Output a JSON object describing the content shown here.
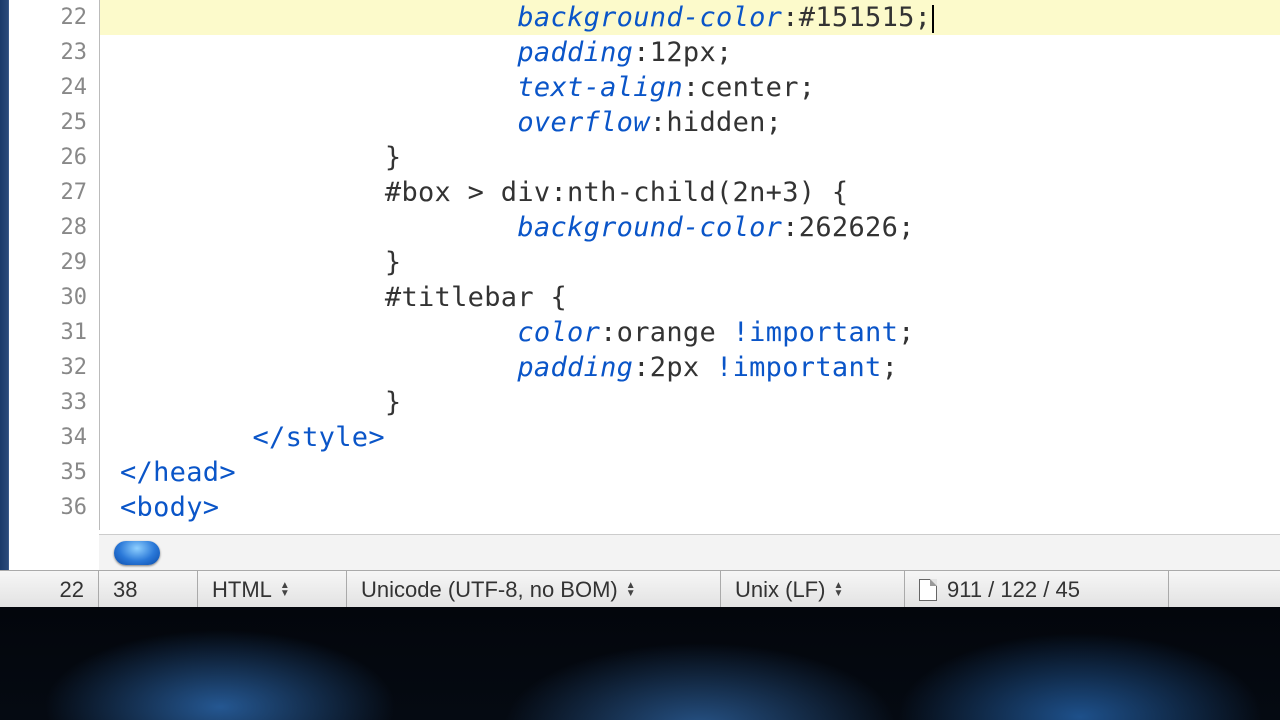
{
  "lines": [
    {
      "n": 22,
      "html": "                        <span class='prop'>background-color</span>:#151515;",
      "current": true
    },
    {
      "n": 23,
      "html": "                        <span class='prop'>padding</span>:12px;"
    },
    {
      "n": 24,
      "html": "                        <span class='prop'>text-align</span>:center;"
    },
    {
      "n": 25,
      "html": "                        <span class='prop'>overflow</span>:hidden;"
    },
    {
      "n": 26,
      "html": "                }"
    },
    {
      "n": 27,
      "html": "                #box &gt; div:nth-child(2n+3) {"
    },
    {
      "n": 28,
      "html": "                        <span class='prop'>background-color</span>:262626;"
    },
    {
      "n": 29,
      "html": "                }"
    },
    {
      "n": 30,
      "html": "                #titlebar {"
    },
    {
      "n": 31,
      "html": "                        <span class='prop'>color</span>:orange <span class='imp'>!important</span>;"
    },
    {
      "n": 32,
      "html": "                        <span class='prop'>padding</span>:2px <span class='imp'>!important</span>;"
    },
    {
      "n": 33,
      "html": "                }"
    },
    {
      "n": 34,
      "html": "        <span class='tag'>&lt;/style&gt;</span>"
    },
    {
      "n": 35,
      "html": "<span class='tag'>&lt;/head&gt;</span>"
    },
    {
      "n": 36,
      "html": "<span class='tag'>&lt;body&gt;</span>"
    }
  ],
  "status": {
    "line": "22",
    "column": "38",
    "language": "HTML",
    "encoding": "Unicode (UTF-8, no BOM)",
    "line_endings": "Unix (LF)",
    "stats": "911 / 122 / 45"
  }
}
